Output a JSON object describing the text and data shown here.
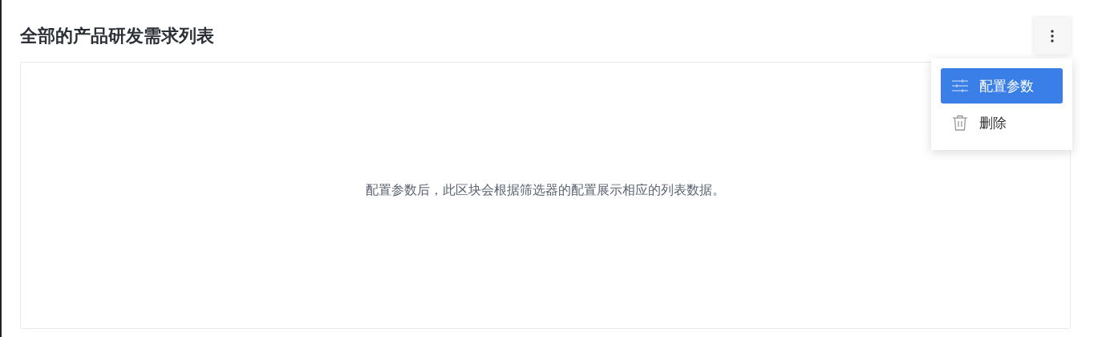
{
  "title": "全部的产品研发需求列表",
  "more_menu": {
    "expanded": true,
    "items": [
      {
        "kind": "settings",
        "label": "配置参数",
        "selected": true
      },
      {
        "kind": "delete",
        "label": "删除",
        "selected": false
      }
    ]
  },
  "empty_message": "配置参数后，此区块会根据筛选器的配置展示相应的列表数据。"
}
